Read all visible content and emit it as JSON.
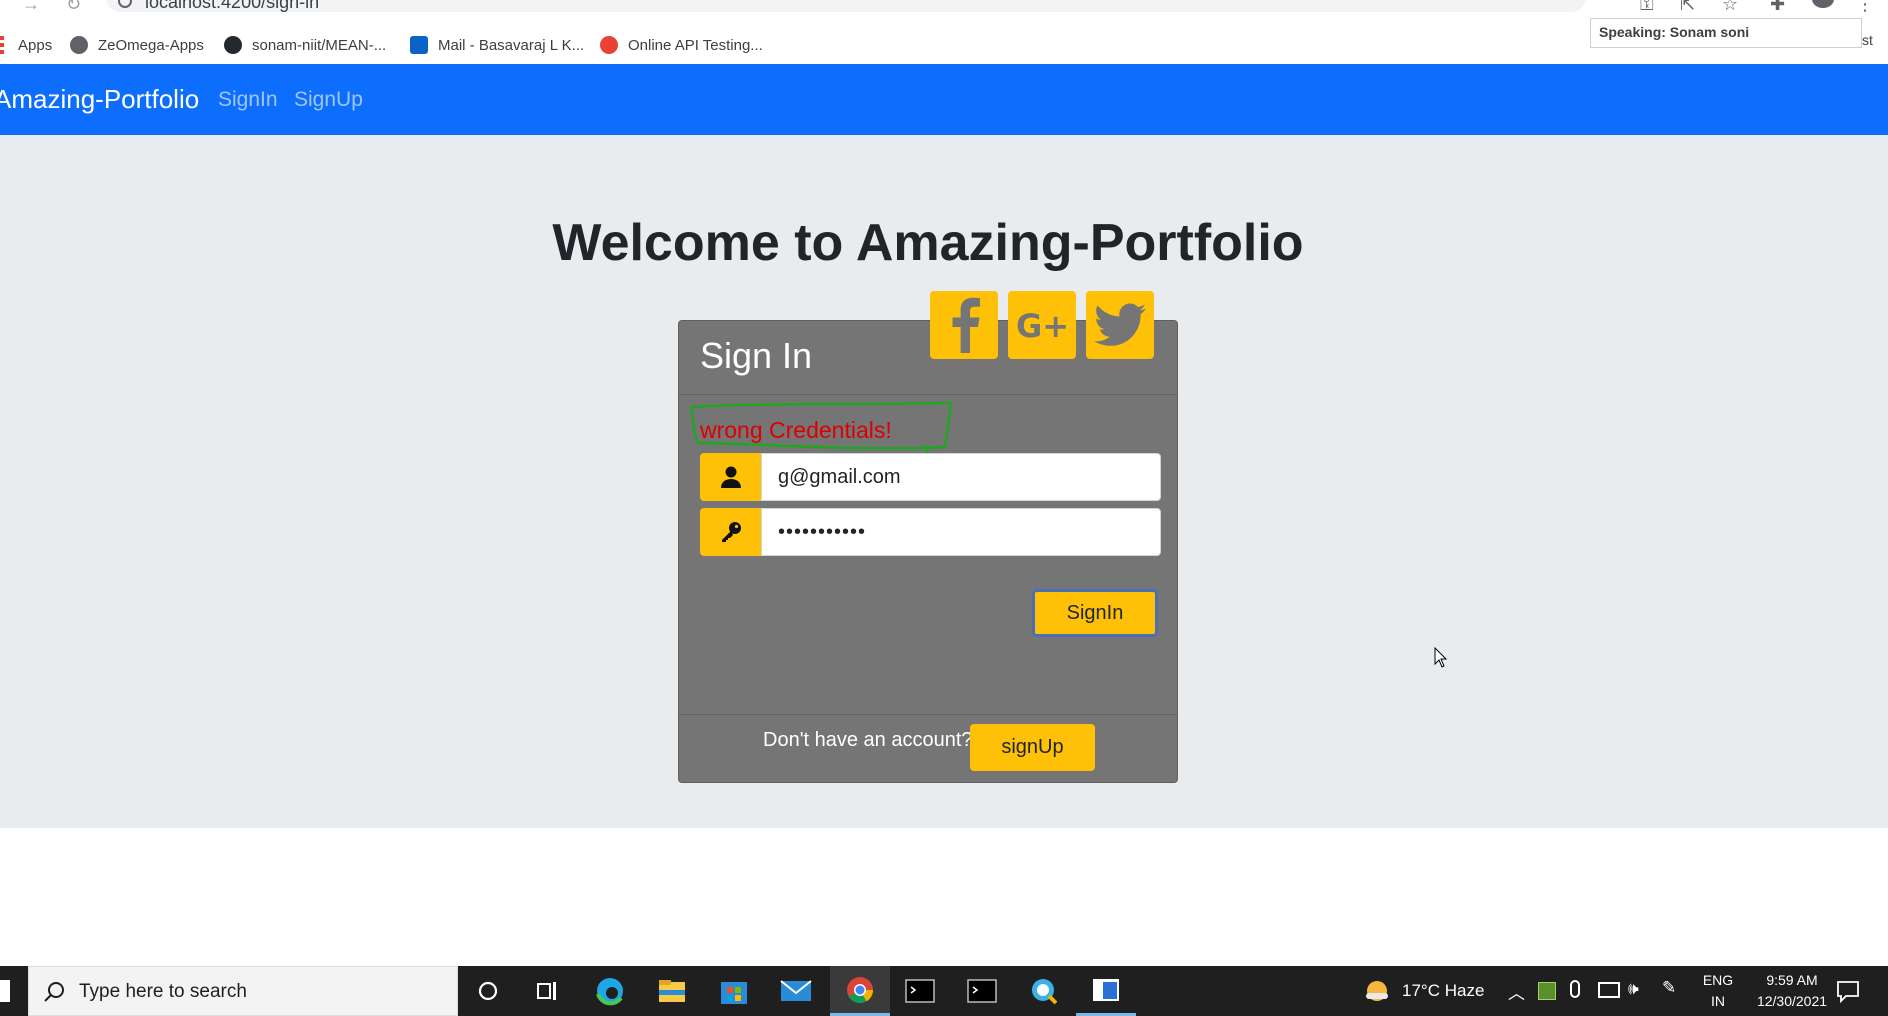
{
  "browser": {
    "url": "localhost:4200/sign-in",
    "bookmarks": [
      {
        "label": "Apps"
      },
      {
        "label": "ZeOmega-Apps"
      },
      {
        "label": "sonam-niit/MEAN-..."
      },
      {
        "label": "Mail - Basavaraj L K..."
      },
      {
        "label": "Online API Testing..."
      }
    ],
    "tooltip": "Speaking: Sonam soni",
    "tooltip_tail": "st"
  },
  "navbar": {
    "brand": "Amazing-Portfolio",
    "links": [
      "SignIn",
      "SignUp"
    ],
    "color": "#0d6efd"
  },
  "page": {
    "heading": "Welcome to Amazing-Portfolio"
  },
  "card": {
    "title": "Sign In",
    "social": [
      "facebook-icon",
      "google-plus-icon",
      "twitter-icon"
    ],
    "error": "wrong Credentials!",
    "email_value": "g@gmail.com",
    "password_value": "•••••••••••",
    "signin_label": "SignIn",
    "footer_text": "Don't have an account?",
    "signup_label": "signUp",
    "accent": "#ffc107"
  },
  "taskbar": {
    "search_placeholder": "Type here to search",
    "weather": "17°C  Haze",
    "lang_top": "ENG",
    "lang_bottom": "IN",
    "time": "9:59 AM",
    "date": "12/30/2021"
  }
}
